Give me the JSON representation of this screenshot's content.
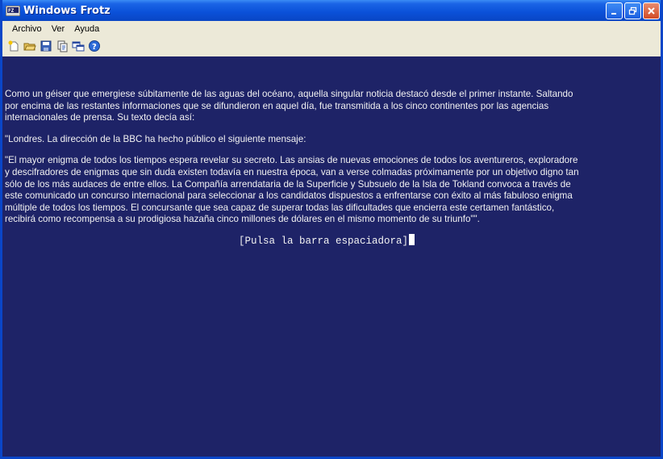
{
  "window": {
    "title": "Windows Frotz",
    "app_icon": "frotz-app-icon",
    "controls": [
      "minimize-icon",
      "restore-icon",
      "close-icon"
    ]
  },
  "menu": {
    "items": [
      "Archivo",
      "Ver",
      "Ayuda"
    ]
  },
  "toolbar": {
    "icons": [
      "new-icon",
      "open-icon",
      "save-icon",
      "copy-icon",
      "options-icon",
      "help-icon"
    ]
  },
  "colors": {
    "game_background": "#1e2367",
    "game_text": "#f2f2f2",
    "titlebar": "#0a50d8"
  },
  "story": {
    "para1": [
      "Como un géiser que emergiese súbitamente de las aguas del océano, aquella singular noticia destacó desde el primer instante. Saltando",
      "por encima de las restantes informaciones que se difundieron en aquel día, fue transmitida a los cinco continentes por las agencias",
      "internacionales de prensa. Su texto decía así:"
    ],
    "para2": "\"Londres. La dirección de la BBC ha hecho público el siguiente mensaje:",
    "para3": [
      "\"El mayor enigma de todos los tiempos espera revelar su secreto. Las ansias de nuevas emociones de todos los aventureros, exploradore",
      "y descifradores de enigmas que sin duda existen todavía en nuestra época, van a verse colmadas próximamente por un objetivo digno tan",
      "sólo de los más audaces de entre ellos. La Compañía arrendataria de la Superficie y Subsuelo de la Isla de Tokland convoca a través de",
      "este comunicado un concurso internacional para seleccionar a los candidatos dispuestos a enfrentarse con éxito al más fabuloso enigma",
      "múltiple de todos los tiempos. El concursante que sea capaz de superar todas las dificultades que encierra este certamen fantástico,",
      "recibirá como recompensa a su prodigiosa hazaña cinco millones de dólares en el mismo momento de su triunfo\"\"."
    ],
    "prompt": "[Pulsa la barra espaciadora]"
  }
}
